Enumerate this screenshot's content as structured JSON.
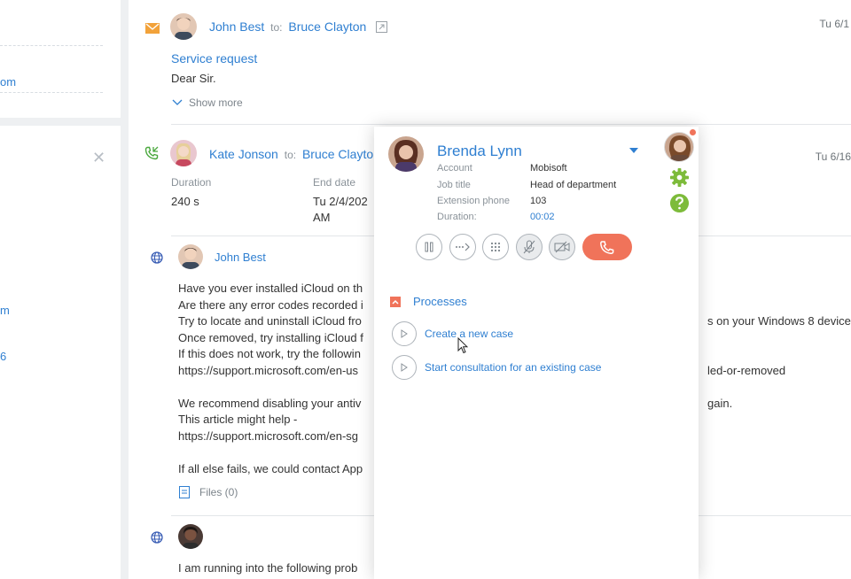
{
  "left": {
    "row1": "om",
    "row2": "m",
    "row3": "6"
  },
  "feed": {
    "item1": {
      "from": "John Best",
      "to_label": "to:",
      "to": "Bruce Clayton",
      "date": "Tu 6/1",
      "subject": "Service request",
      "preview": "Dear Sir.",
      "show_more": "Show more"
    },
    "item2": {
      "from": "Kate Jonson",
      "to_label": "to:",
      "to": "Bruce Clayto",
      "date": "Tu 6/16",
      "duration_label": "Duration",
      "duration_value": "240 s",
      "end_label": "End date",
      "end_value1": "Tu 2/4/202",
      "end_value2": "AM"
    },
    "item3": {
      "author": "John Best",
      "lines": [
        "Have you ever installed iCloud on th",
        "Are there any error codes recorded i",
        "Try to locate and uninstall iCloud fro",
        "Once removed, try installing iCloud f",
        "If this does not work, try the followin"
      ],
      "link1": "https://support.microsoft.com/en-us",
      "line_after": "We recommend disabling your antiv",
      "line_after2": "This article might help -",
      "link2": "https://support.microsoft.com/en-sg",
      "line_last": "If all else fails, we could contact App",
      "files": "Files (0)",
      "right_frag1": "s on your Windows 8 device.",
      "right_frag2": "led-or-removed",
      "right_frag3": "gain."
    },
    "item4": {
      "line": "I am running into the following prob"
    }
  },
  "panel": {
    "name": "Brenda Lynn",
    "fields": [
      {
        "label": "Account",
        "value": "Mobisoft"
      },
      {
        "label": "Job title",
        "value": "Head of department"
      },
      {
        "label": "Extension phone",
        "value": "103"
      },
      {
        "label": "Duration:",
        "value": "00:02"
      }
    ],
    "processes_title": "Processes",
    "processes": [
      "Create a new case",
      "Start consultation for an existing case"
    ]
  },
  "colors": {
    "accent": "#2f7fd1",
    "hangup": "#f0735a",
    "gear": "#7dbb3a",
    "email_icon": "#f2a23a",
    "call_icon": "#4aa83d"
  }
}
